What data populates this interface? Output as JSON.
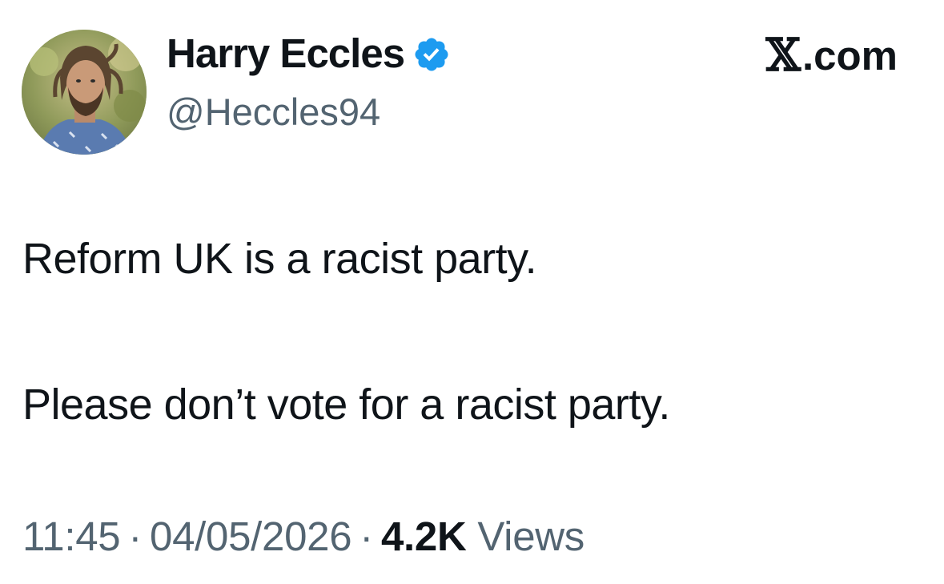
{
  "author": {
    "display_name": "Harry Eccles",
    "handle": "@Heccles94",
    "verified_icon": "verified-badge-icon",
    "badge_color": "#1d9bf0"
  },
  "brand": {
    "mark": "𝕏",
    "suffix": ".com"
  },
  "tweet": {
    "lines": [
      "Reform UK is a racist party.",
      "Please don’t vote for a racist party."
    ]
  },
  "meta": {
    "time": "11:45",
    "separator": "·",
    "date": "04/05/2026",
    "views_count": "4.2K",
    "views_label": "Views"
  },
  "colors": {
    "text_primary": "#0f1419",
    "text_secondary": "#536471",
    "background": "#ffffff"
  }
}
